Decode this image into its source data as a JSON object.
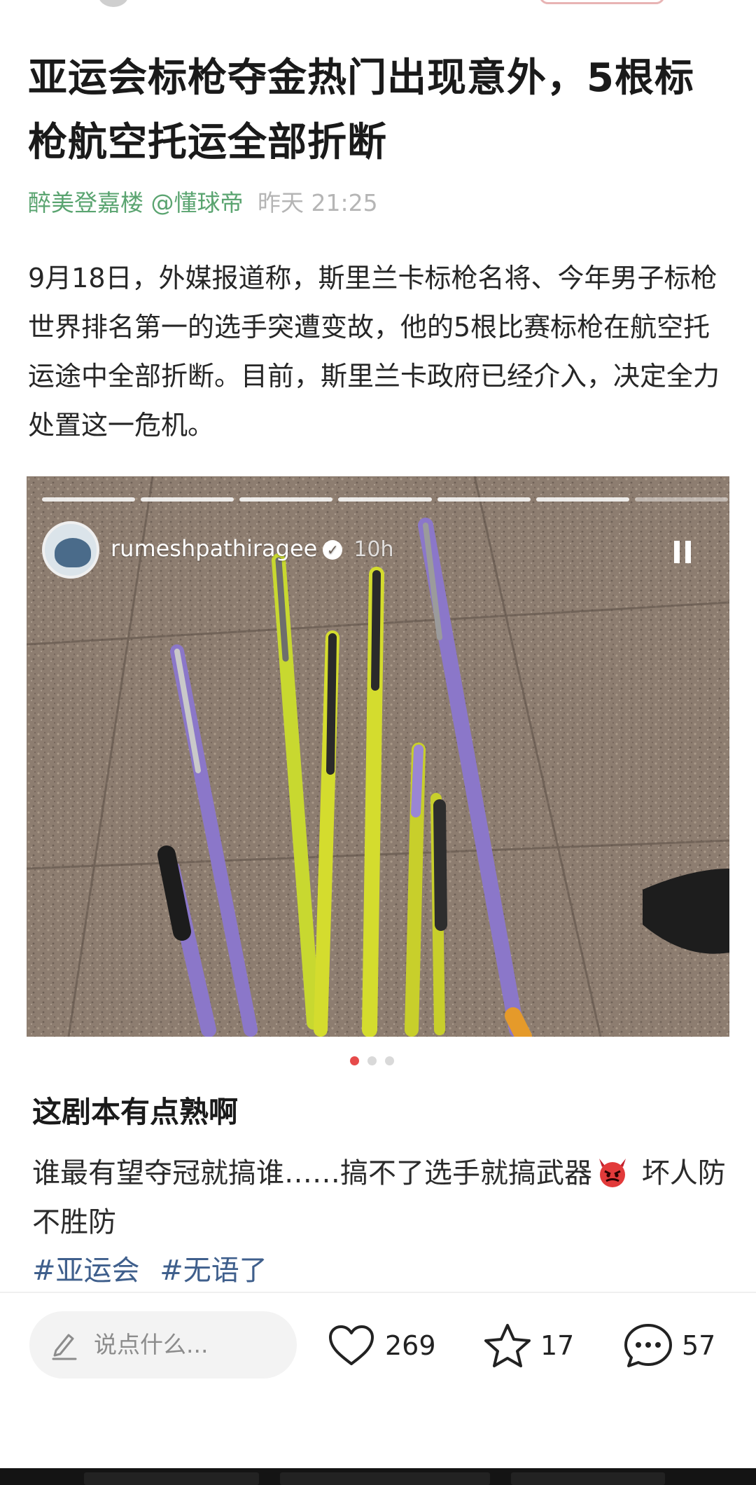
{
  "article": {
    "title": "亚运会标枪夺金热门出现意外，5根标枪航空托运全部折断",
    "author": "醉美登嘉楼 @懂球帝",
    "time": "昨天 21:25",
    "body": "9月18日，外媒报道称，斯里兰卡标枪名将、今年男子标枪世界排名第一的选手突遭变故，他的5根比赛标枪在航空托运途中全部折断。目前，斯里兰卡政府已经介入，决定全力处置这一危机。"
  },
  "story": {
    "username": "rumeshpathiragee",
    "verified_icon": "verified-check-icon",
    "age": "10h",
    "progress_segments": 7
  },
  "carousel": {
    "count": 3,
    "active": 1
  },
  "comment": {
    "title": "这剧本有点熟啊",
    "text_before_emoji": "谁最有望夺冠就搞谁……搞不了选手就搞武器",
    "emoji": "devil-face-icon",
    "text_after_emoji": " 坏人防不胜防",
    "tags": [
      "#亚运会",
      "#无语了"
    ]
  },
  "actions": {
    "input_placeholder": "说点什么...",
    "likes": "269",
    "favorites": "17",
    "comments": "57"
  },
  "colors": {
    "author_green": "#5aa470",
    "tag_blue": "#3f5f8c",
    "dot_active": "#e64a4a"
  }
}
